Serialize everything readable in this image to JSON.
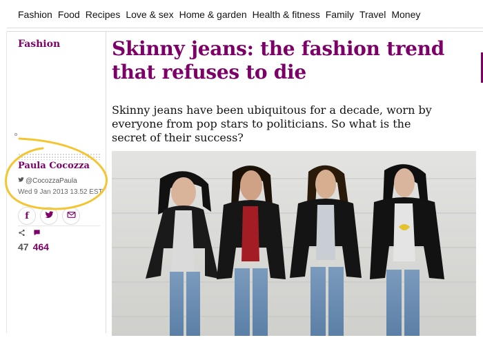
{
  "nav": {
    "items": [
      "Fashion",
      "Food",
      "Recipes",
      "Love & sex",
      "Home & garden",
      "Health & fitness",
      "Family",
      "Travel",
      "Money"
    ]
  },
  "article": {
    "section": "Fashion",
    "headline": "Skinny jeans: the fashion trend that refuses to die",
    "standfirst": "Skinny jeans have been ubiquitous for a decade, worn by everyone from pop stars to politicians. So what is the secret of their success?"
  },
  "byline": {
    "author": "Paula Cocozza",
    "twitter_handle": "@CocozzaPaula",
    "date": "Wed 9 Jan 2013 13.52 EST"
  },
  "share": {
    "facebook_label": "f",
    "share_count": "47",
    "comment_count": "464"
  },
  "colors": {
    "accent": "#7d0068",
    "annotation": "#f3c531"
  }
}
